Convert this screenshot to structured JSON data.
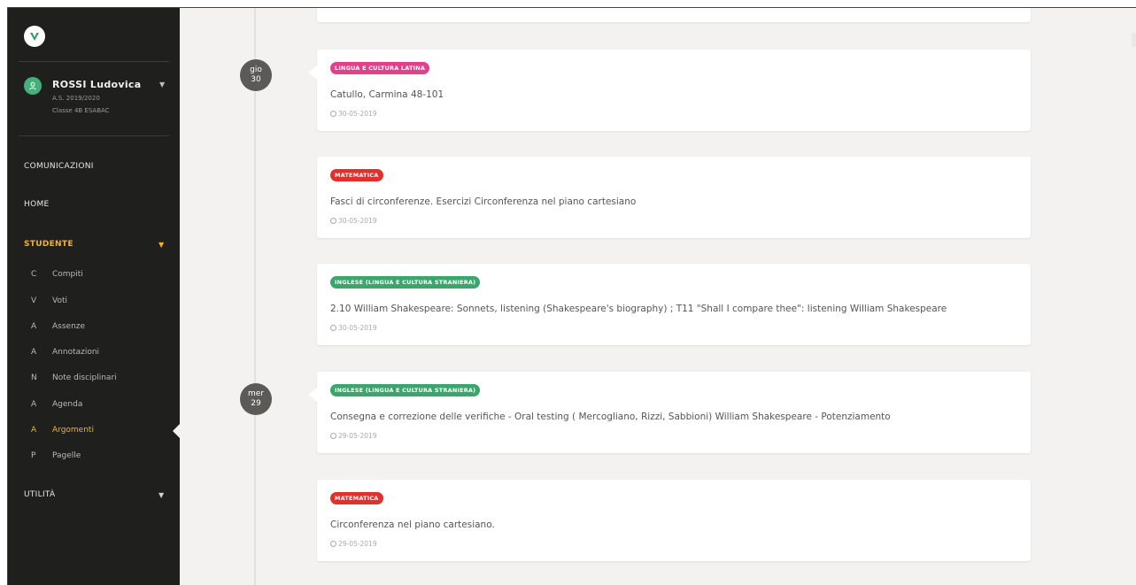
{
  "user": {
    "name": "ROSSI Ludovica",
    "year": "A.S. 2019/2020",
    "class": "Classe 4B ESABAC"
  },
  "nav": {
    "comunicazioni": "COMUNICAZIONI",
    "home": "HOME",
    "studente": "STUDENTE",
    "utilita": "UTILITÀ"
  },
  "student_items": [
    {
      "letter": "C",
      "label": "Compiti"
    },
    {
      "letter": "V",
      "label": "Voti"
    },
    {
      "letter": "A",
      "label": "Assenze"
    },
    {
      "letter": "A",
      "label": "Annotazioni"
    },
    {
      "letter": "N",
      "label": "Note disciplinari"
    },
    {
      "letter": "A",
      "label": "Agenda"
    },
    {
      "letter": "A",
      "label": "Argomenti"
    },
    {
      "letter": "P",
      "label": "Pagelle"
    }
  ],
  "dates": [
    {
      "day": "gio",
      "num": "30"
    },
    {
      "day": "mer",
      "num": "29"
    }
  ],
  "cards": [
    {
      "tag": "LINGUA E CULTURA LATINA",
      "color": "#e2408a",
      "title": "Catullo, Carmina 48-101",
      "date": "30-05-2019"
    },
    {
      "tag": "MATEMATICA",
      "color": "#e0312c",
      "title": "Fasci di circonferenze. Esercizi Circonferenza nel piano cartesiano",
      "date": "30-05-2019"
    },
    {
      "tag": "INGLESE (LINGUA E CULTURA STRANIERA)",
      "color": "#3aa66c",
      "title": "2.10 William Shakespeare: Sonnets, listening (Shakespeare's biography) ; T11 \"Shall I compare thee\": listening William Shakespeare",
      "date": "30-05-2019"
    },
    {
      "tag": "INGLESE (LINGUA E CULTURA STRANIERA)",
      "color": "#3aa66c",
      "title": "Consegna e correzione delle verifiche - Oral testing ( Mercogliano, Rizzi, Sabbioni) William Shakespeare - Potenziamento",
      "date": "29-05-2019"
    },
    {
      "tag": "MATEMATICA",
      "color": "#e0312c",
      "title": "Circonferenza nel piano cartesiano.",
      "date": "29-05-2019"
    }
  ]
}
